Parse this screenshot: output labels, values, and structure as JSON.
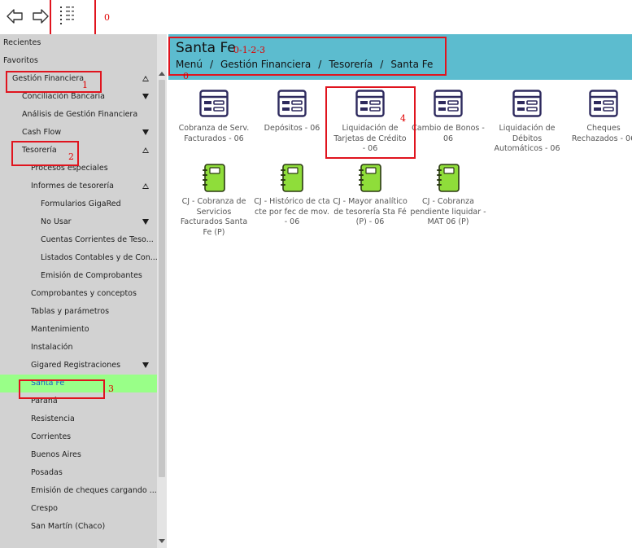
{
  "annotations": {
    "a0": "0",
    "a1": "1",
    "a2": "2",
    "a3": "3",
    "a4": "4",
    "a_header": "0-1-2-3",
    "a_header2": "0"
  },
  "sidebar": {
    "items": [
      {
        "label": "Recientes"
      },
      {
        "label": "Favoritos"
      },
      {
        "label": "Gestión Financiera"
      },
      {
        "label": "Conciliación Bancaria"
      },
      {
        "label": "Análisis de Gestión Financiera"
      },
      {
        "label": "Cash Flow"
      },
      {
        "label": "Tesorería"
      },
      {
        "label": "Procesos especiales"
      },
      {
        "label": "Informes de tesorería"
      },
      {
        "label": "Formularios GigaRed"
      },
      {
        "label": "No Usar"
      },
      {
        "label": "Cuentas Corrientes de Teso..."
      },
      {
        "label": "Listados Contables y de Con..."
      },
      {
        "label": "Emisión de Comprobantes"
      },
      {
        "label": "Comprobantes y conceptos"
      },
      {
        "label": "Tablas y parámetros"
      },
      {
        "label": "Mantenimiento"
      },
      {
        "label": "Instalación"
      },
      {
        "label": "Gigared Registraciones"
      },
      {
        "label": "Santa Fe"
      },
      {
        "label": "Paraná"
      },
      {
        "label": "Resistencia"
      },
      {
        "label": "Corrientes"
      },
      {
        "label": "Buenos Aires"
      },
      {
        "label": "Posadas"
      },
      {
        "label": "Emisión de cheques cargando ..."
      },
      {
        "label": "Crespo"
      },
      {
        "label": "San Martín (Chaco)"
      }
    ]
  },
  "header": {
    "title": "Santa Fe",
    "breadcrumb": [
      "Menú",
      "Gestión Financiera",
      "Tesorería",
      "Santa Fe"
    ],
    "separator": "/"
  },
  "tiles": [
    {
      "lines": [
        "Cobranza de Serv.",
        "Facturados - 06"
      ],
      "icon": "form-icon"
    },
    {
      "lines": [
        "Depósitos - 06"
      ],
      "icon": "form-icon"
    },
    {
      "lines": [
        "Liquidación de",
        "Tarjetas de Crédito",
        "- 06"
      ],
      "icon": "form-icon"
    },
    {
      "lines": [
        "Cambio de Bonos -",
        "06"
      ],
      "icon": "form-icon"
    },
    {
      "lines": [
        "Liquidación de",
        "Débitos",
        "Automáticos - 06"
      ],
      "icon": "form-icon"
    },
    {
      "lines": [
        "Cheques",
        "Rechazados - 06"
      ],
      "icon": "form-icon"
    },
    {
      "lines": [
        "CJ - Cobranza de",
        "Servicios",
        "Facturados Santa",
        "Fe (P)"
      ],
      "icon": "notebook-icon"
    },
    {
      "lines": [
        "CJ - Histórico de cta",
        "cte por fec de mov.",
        "- 06"
      ],
      "icon": "notebook-icon"
    },
    {
      "lines": [
        "CJ - Mayor analítico",
        "de tesorería Sta Fé",
        "(P) - 06"
      ],
      "icon": "notebook-icon"
    },
    {
      "lines": [
        "CJ - Cobranza",
        "pendiente liquidar -",
        "MAT 06 (P)"
      ],
      "icon": "notebook-icon"
    }
  ],
  "colors": {
    "header_bg": "#5cbccf",
    "sidebar_bg": "#d2d2d2",
    "selected_bg": "#99ff88",
    "selected_text": "#1560c8",
    "form_icon": "#2e2a5e",
    "notebook_icon": "#8fdd3a",
    "annotation_red": "#e0141e"
  }
}
